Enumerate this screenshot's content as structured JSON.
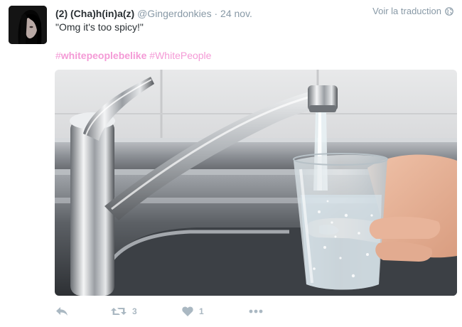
{
  "tweet": {
    "display_name": "(2) (Cha)h(in)a(z)",
    "handle": "@Gingerdonkies",
    "separator": "·",
    "date": "24 nov.",
    "translate_label": "Voir la traduction",
    "text": "\"Omg it's too spicy!\"",
    "hashtags": [
      {
        "symbol": "#",
        "tag": "whitepeoplebelike"
      },
      {
        "symbol": "#",
        "tag": "WhitePeople"
      }
    ],
    "retweet_count": "3",
    "like_count": "1"
  },
  "icons": {
    "translate": "globe-icon",
    "reply": "reply-icon",
    "retweet": "retweet-icon",
    "like": "heart-icon",
    "more": "more-dots-icon"
  },
  "colors": {
    "hashtag": "#f49ad6",
    "action_gray": "#aab8c2",
    "meta_gray": "#8899a6"
  }
}
